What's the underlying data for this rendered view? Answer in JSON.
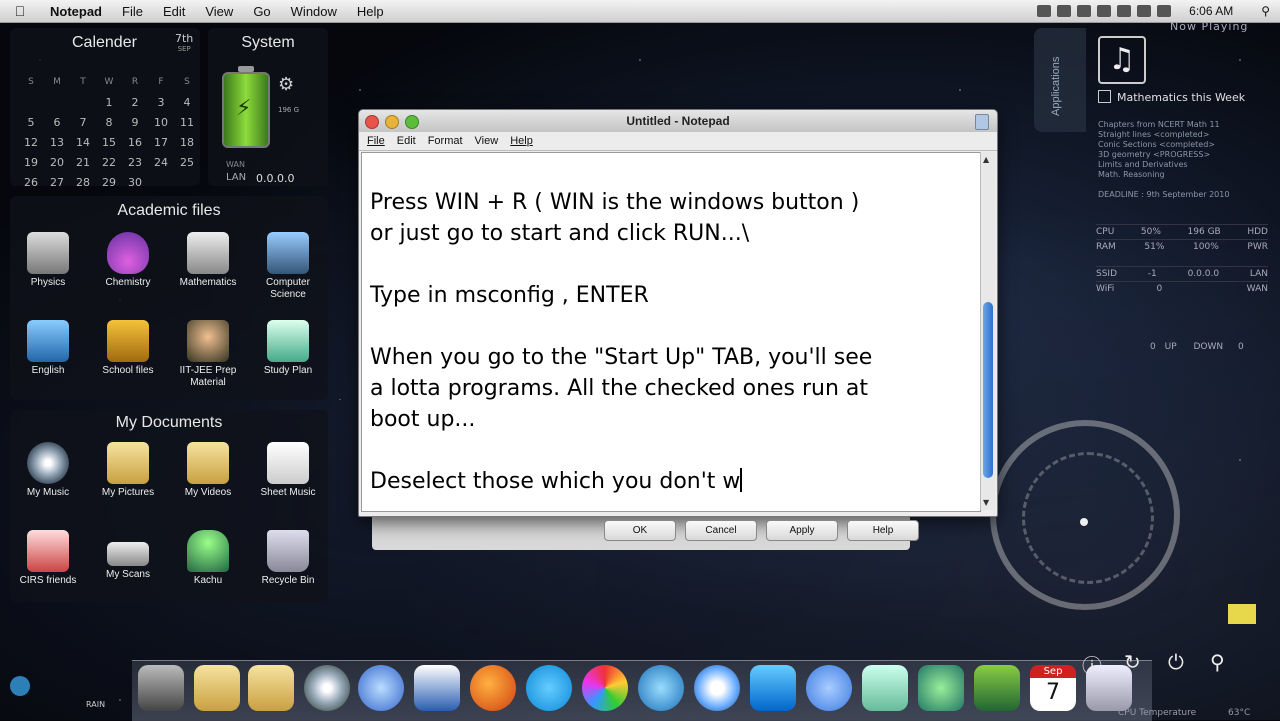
{
  "menubar": {
    "app_name": "Notepad",
    "items": [
      "File",
      "Edit",
      "View",
      "Go",
      "Window",
      "Help"
    ],
    "clock": "6:06 AM"
  },
  "calendar": {
    "title": "Calender",
    "date_day": "7th",
    "date_month": "SEP",
    "weekdays": [
      "S",
      "M",
      "T",
      "W",
      "R",
      "F",
      "S"
    ],
    "weeks": [
      [
        "",
        "",
        "",
        "1",
        "2",
        "3",
        "4"
      ],
      [
        "5",
        "6",
        "7",
        "8",
        "9",
        "10",
        "11"
      ],
      [
        "12",
        "13",
        "14",
        "15",
        "16",
        "17",
        "18"
      ],
      [
        "19",
        "20",
        "21",
        "22",
        "23",
        "24",
        "25"
      ],
      [
        "26",
        "27",
        "28",
        "29",
        "30",
        "",
        ""
      ]
    ]
  },
  "system": {
    "title": "System",
    "disk_label": "196 G",
    "wan_label": "WAN",
    "lan_label": "LAN",
    "lan_value": "0.0.0.0"
  },
  "academic": {
    "title": "Academic files",
    "items": [
      {
        "label": "Physics",
        "icon": "physics-icon"
      },
      {
        "label": "Chemistry",
        "icon": "flask-icon"
      },
      {
        "label": "Mathematics",
        "icon": "robot-icon"
      },
      {
        "label": "Computer Science",
        "icon": "laptop-icon"
      },
      {
        "label": "English",
        "icon": "book-icon"
      },
      {
        "label": "School files",
        "icon": "backpack-icon"
      },
      {
        "label": "IIT-JEE Prep Material",
        "icon": "graduate-icon"
      },
      {
        "label": "Study Plan",
        "icon": "spreadsheet-icon"
      }
    ]
  },
  "mydocs": {
    "title": "My Documents",
    "items": [
      {
        "label": "My Music",
        "icon": "disc-icon"
      },
      {
        "label": "My Pictures",
        "icon": "folder-pictures-icon"
      },
      {
        "label": "My Videos",
        "icon": "folder-videos-icon"
      },
      {
        "label": "Sheet Music",
        "icon": "sheet-music-icon"
      },
      {
        "label": "CIRS friends",
        "icon": "folder-icon"
      },
      {
        "label": "My Scans",
        "icon": "scanner-icon"
      },
      {
        "label": "Kachu",
        "icon": "trophy-icon"
      },
      {
        "label": "Recycle Bin",
        "icon": "recycle-bin-icon"
      }
    ]
  },
  "right_widgets": {
    "apps_tab": "Applications",
    "now_playing": "Now Playing",
    "math_week": "Mathematics this Week",
    "chapters": [
      "Chapters from NCERT Math 11",
      "Straight lines <completed>",
      "Conic Sections <completed>",
      "3D geometry <PROGRESS>",
      "Limits and Derivatives",
      "Math. Reasoning"
    ],
    "deadline": "DEADLINE : 9th September 2010",
    "stats": [
      {
        "a": "CPU",
        "b": "50%",
        "c": "196 GB",
        "d": "HDD"
      },
      {
        "a": "RAM",
        "b": "51%",
        "c": "100%",
        "d": "PWR"
      },
      {
        "a": "SSID",
        "b": "-1",
        "c": "0.0.0.0",
        "d": "LAN"
      },
      {
        "a": "WiFi",
        "b": "0",
        "c": "",
        "d": "WAN"
      }
    ],
    "up_label": "UP",
    "up_value": "0",
    "down_label": "DOWN",
    "down_value": "0",
    "rain_label": "RAIN",
    "cpu_temp_label": "CPU Temperature",
    "cpu_temp_value": "63°C"
  },
  "notepad": {
    "title": "Untitled - Notepad",
    "menu": [
      "File",
      "Edit",
      "Format",
      "View",
      "Help"
    ],
    "text": "Press WIN + R ( WIN is the windows button )\nor just go to start and click RUN...\\\n\nType in msconfig , ENTER\n\nWhen you go to the \"Start Up\" TAB, you'll see\na lotta programs. All the checked ones run at\nboot up...\n\nDeselect those which you don't w"
  },
  "dialog_buttons": {
    "ok": "OK",
    "cancel": "Cancel",
    "apply": "Apply",
    "help": "Help"
  },
  "dock": {
    "items": [
      "finder-icon",
      "folder-icon",
      "folder-icon",
      "dvd-icon",
      "itunes-icon",
      "word-icon",
      "firefox-icon",
      "skype-icon",
      "picasa-icon",
      "ie-icon",
      "safari-icon",
      "teamviewer-icon",
      "flickr-icon",
      "notes-icon",
      "network-icon",
      "photos-icon",
      "calendar-icon",
      "window-icon"
    ],
    "calendar_month": "Sep",
    "calendar_day": "7"
  }
}
